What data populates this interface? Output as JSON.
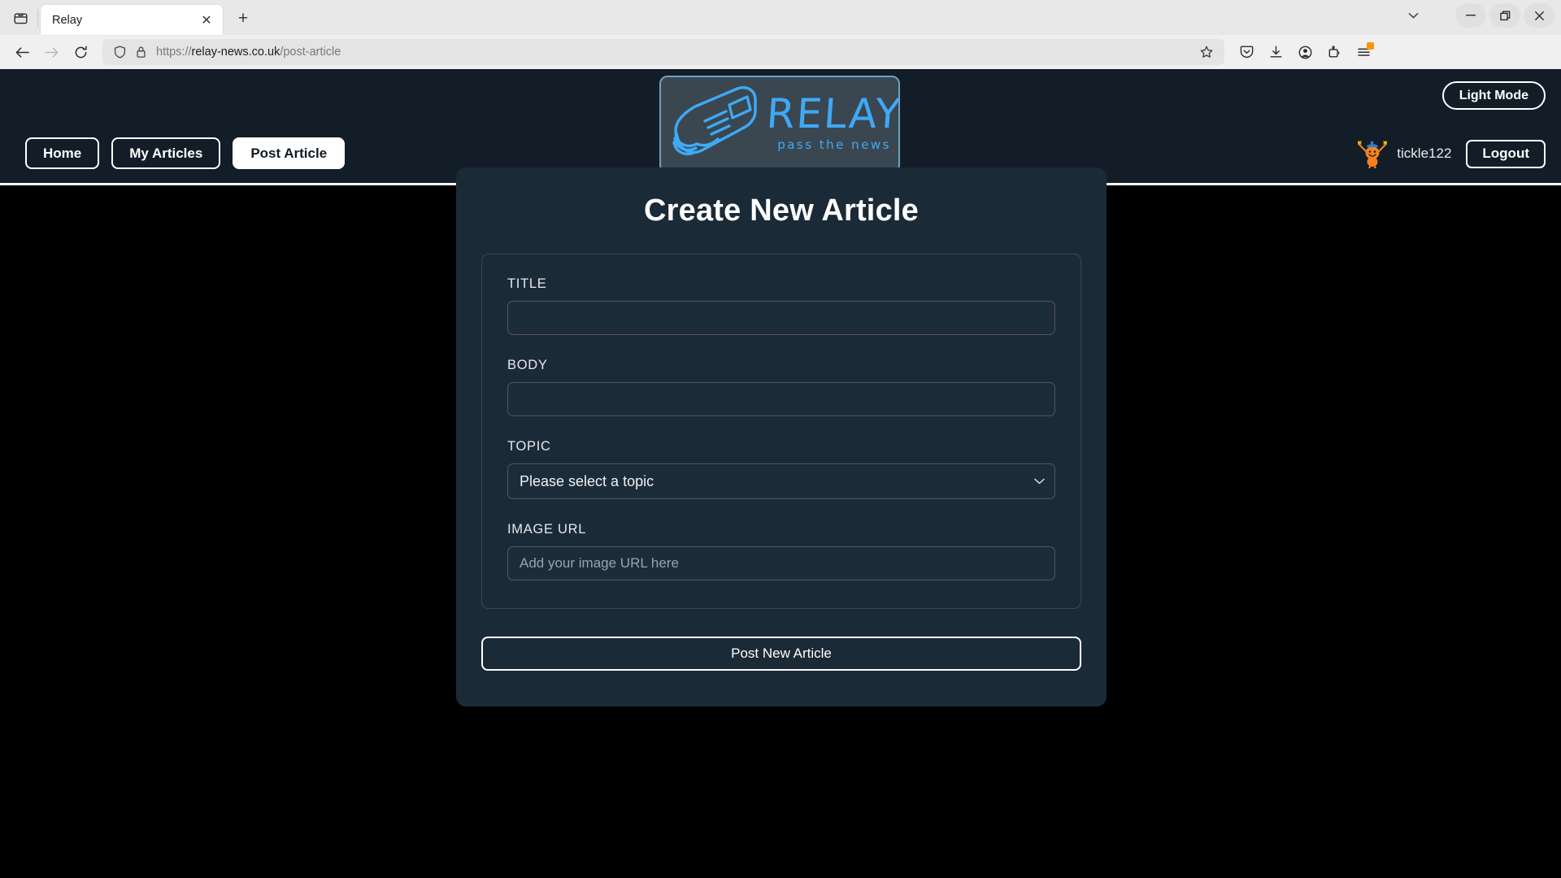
{
  "browser": {
    "tab": {
      "title": "Relay",
      "close_label": "✕"
    },
    "new_tab_label": "+",
    "url": {
      "protocol": "https://",
      "host": "relay-news.co.uk",
      "path": "/post-article"
    },
    "icons": {
      "firefox_view": "firefox-view-icon",
      "back": "back-arrow-icon",
      "forward": "forward-arrow-icon",
      "reload": "reload-icon",
      "shield": "tracking-shield-icon",
      "lock": "padlock-icon",
      "bookmark": "bookmark-star-icon",
      "pocket": "save-to-pocket-icon",
      "downloads": "downloads-icon",
      "account": "account-icon",
      "extensions": "extensions-icon",
      "app_menu": "hamburger-menu-icon",
      "tab_list": "list-all-tabs-icon",
      "minimize": "minimize-icon",
      "restore": "restore-icon",
      "close": "close-window-icon"
    }
  },
  "site": {
    "logo": {
      "word": "RELAY",
      "tagline": "pass the news",
      "mark": "rolled-newspaper-icon"
    },
    "nav": [
      {
        "label": "Home",
        "name": "nav-home",
        "active": false
      },
      {
        "label": "My Articles",
        "name": "nav-my-articles",
        "active": false
      },
      {
        "label": "Post Article",
        "name": "nav-post-article",
        "active": true
      }
    ],
    "theme_toggle_label": "Light Mode",
    "username": "tickle122",
    "logout_label": "Logout",
    "avatar": "tickle-character-avatar"
  },
  "form": {
    "heading": "Create New Article",
    "fields": {
      "title": {
        "label": "TITLE",
        "value": "",
        "placeholder": ""
      },
      "body": {
        "label": "BODY",
        "value": "",
        "placeholder": ""
      },
      "topic": {
        "label": "TOPIC",
        "selected": "Please select a topic"
      },
      "image_url": {
        "label": "IMAGE URL",
        "value": "",
        "placeholder": "Add your image URL here"
      }
    },
    "submit_label": "Post New Article"
  },
  "colors": {
    "page_bg": "#000000",
    "header_bg": "#121d28",
    "card_bg": "#1b2a37",
    "accent_blue": "#3fa9f5",
    "avatar_orange": "#f5821f",
    "border_white": "#ffffff",
    "input_border": "#5a5550"
  }
}
